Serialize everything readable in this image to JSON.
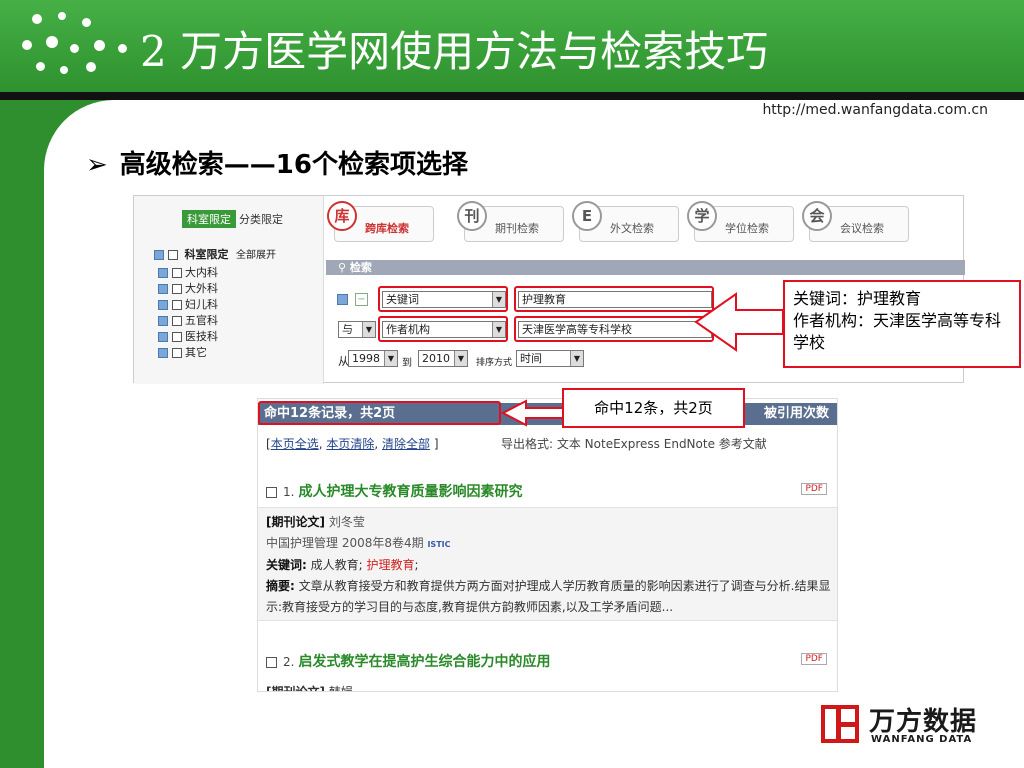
{
  "slide": {
    "title": "2  万方医学网使用方法与检索技巧",
    "url": "http://med.wanfangdata.com.cn",
    "bullet_arrow": "➢",
    "bullet_text": "高级检索——16个检索项选择"
  },
  "colors": {
    "header_green": "#3aa43a",
    "sidebar_green": "#2f8f2f",
    "highlight_red": "#e01020",
    "title_green": "#2a8a2a"
  },
  "search_panel": {
    "left": {
      "tag_active": "科室限定",
      "tag_other": "分类限定",
      "group_label": "科室限定",
      "expand_all": "全部展开",
      "items": [
        "大内科",
        "大外科",
        "妇儿科",
        "五官科",
        "医技科",
        "其它"
      ]
    },
    "tabs": [
      {
        "icon": "库",
        "label": "跨库检索"
      },
      {
        "icon": "刊",
        "label": "期刊检索"
      },
      {
        "icon": "E",
        "label": "外文检索"
      },
      {
        "icon": "学",
        "label": "学位检索"
      },
      {
        "icon": "会",
        "label": "会议检索"
      }
    ],
    "section_label": "检索",
    "row1": {
      "field": "关键词",
      "value": "护理教育"
    },
    "row2": {
      "operator": "与",
      "field": "作者机构",
      "value": "天津医学高等专科学校"
    },
    "row3": {
      "from_label": "从",
      "from_year": "1998",
      "to_label": "到",
      "to_year": "2010",
      "sort_label": "排序方式",
      "sort_value": "时间"
    }
  },
  "annotation1": {
    "line1": "关键词：护理教育",
    "line2": "作者机构：天津医学高等专科学校"
  },
  "annotation2": {
    "text": "命中12条，共2页"
  },
  "results": {
    "summary": "命中12条记录，共2页",
    "sort_right": "被引用次数",
    "link_select": "本页全选",
    "link_clear": "本页清除",
    "link_clear_all": "清除全部",
    "export_label": "导出格式: 文本  NoteExpress  EndNote  参考文献",
    "pdf": "PDF",
    "item1": {
      "num": "1.",
      "title": "成人护理大专教育质量影响因素研究",
      "type": "[期刊论文]",
      "author": "刘冬莹",
      "source": "中国护理管理 2008年8卷4期",
      "istic": "ISTIC",
      "kw_label": "关键词:",
      "kw_plain": "成人教育;",
      "kw_red": "护理教育",
      "kw_end": ";",
      "abs_label": "摘要:",
      "abstract": "文章从教育接受方和教育提供方两方面对护理成人学历教育质量的影响因素进行了调查与分析.结果显示:教育接受方的学习目的与态度,教育提供方韵教师因素,以及工学矛盾问题..."
    },
    "item2": {
      "num": "2.",
      "title": "启发式教学在提高护生综合能力中的应用",
      "type": "[期刊论文]",
      "author": "韩娟"
    }
  },
  "logo": {
    "cn": "万方数据",
    "en": "WANFANG DATA"
  }
}
